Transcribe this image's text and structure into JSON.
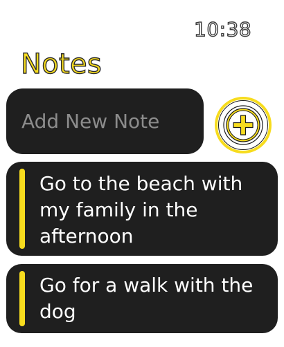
{
  "status": {
    "time": "10:38"
  },
  "header": {
    "title": "Notes"
  },
  "add_note": {
    "placeholder": "Add New Note",
    "add_icon": "plus-circle-icon"
  },
  "notes": [
    {
      "text": "Go to the beach with my family in the afternoon"
    },
    {
      "text": "Go for a walk with the dog"
    }
  ],
  "colors": {
    "accent": "#f7dc1e",
    "card_background": "#1f1f1f",
    "placeholder_text": "#8c8c8c",
    "note_text": "#ffffff"
  }
}
